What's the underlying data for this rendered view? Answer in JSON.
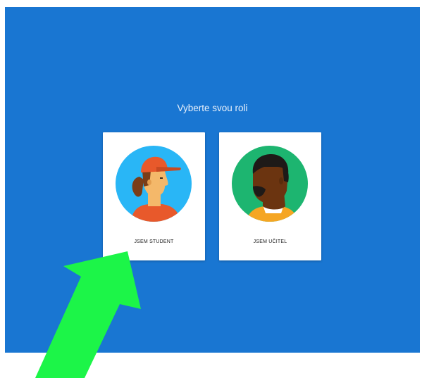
{
  "screen": {
    "title": "Vyberte svou roli"
  },
  "roles": [
    {
      "label": "JSEM STUDENT",
      "icon": "student-avatar-icon"
    },
    {
      "label": "JSEM UČITEL",
      "icon": "teacher-avatar-icon"
    }
  ],
  "colors": {
    "background": "#1976d2",
    "card": "#ffffff",
    "student_circle": "#29b6f6",
    "teacher_circle": "#1db570",
    "annotation_arrow": "#1cf548"
  }
}
